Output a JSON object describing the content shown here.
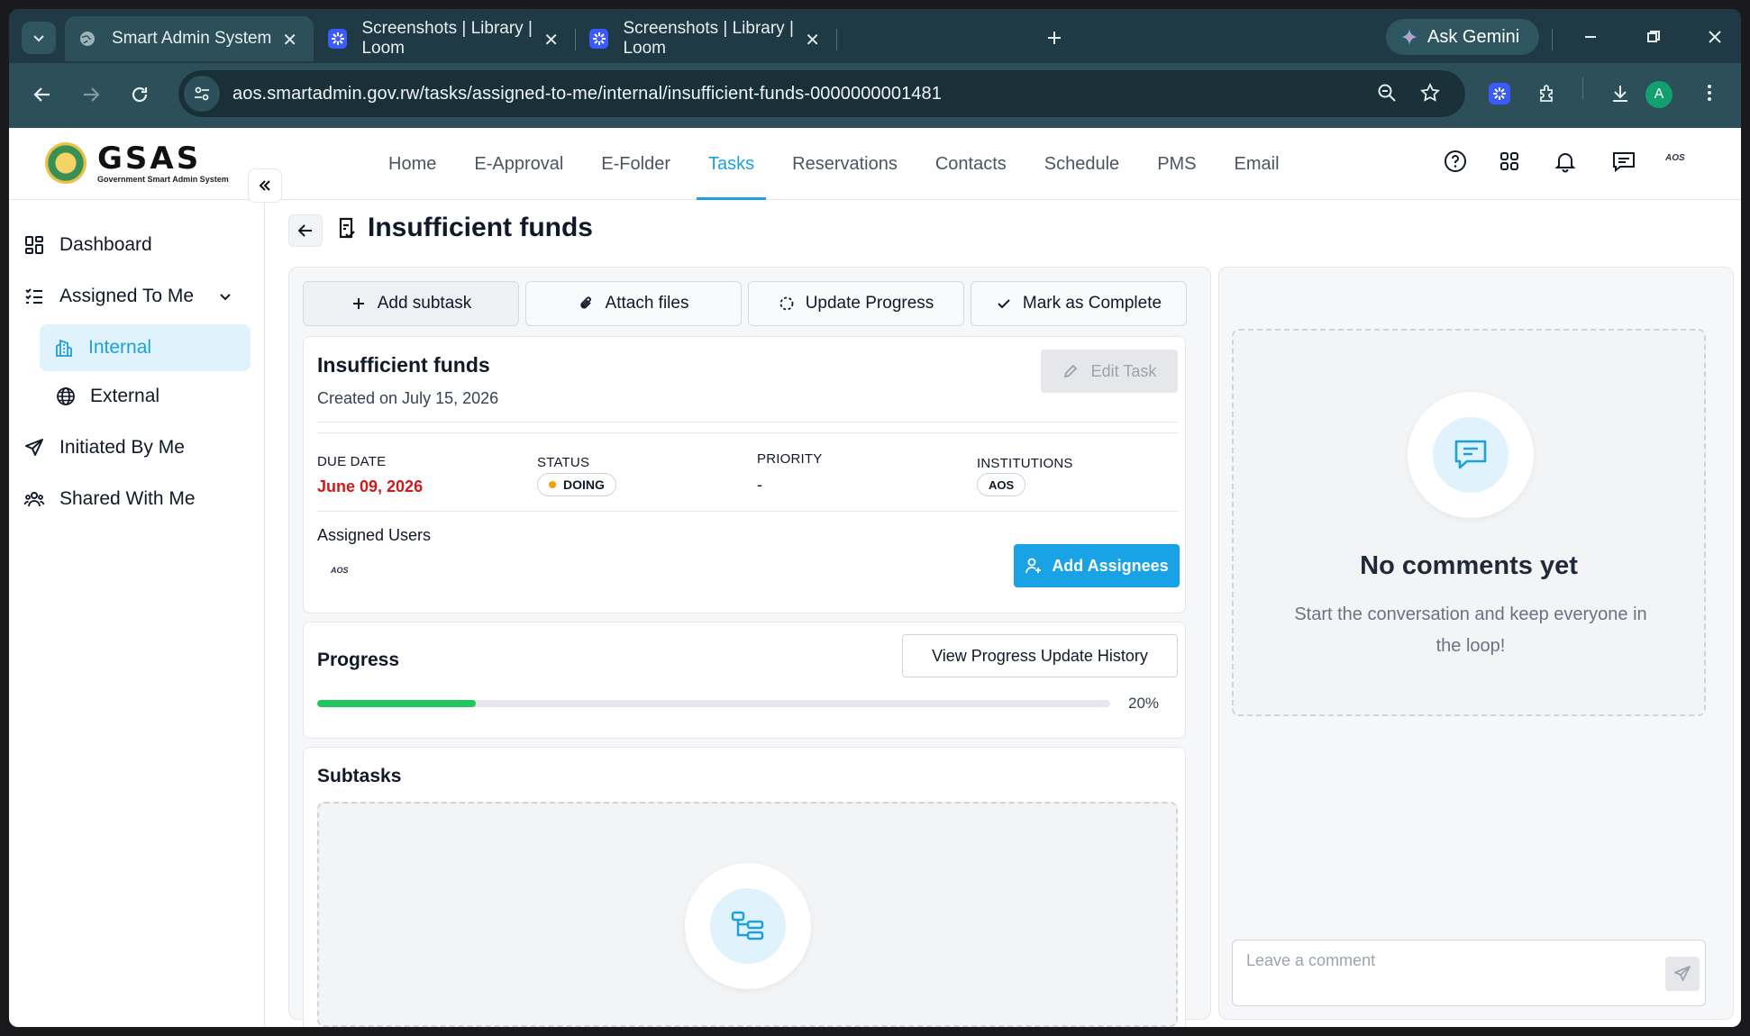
{
  "browser": {
    "tabs": [
      {
        "title": "Smart Admin System",
        "active": true
      },
      {
        "title": "Screenshots | Library | Loom",
        "active": false
      },
      {
        "title": "Screenshots | Library | Loom",
        "active": false
      }
    ],
    "gemini_label": "Ask Gemini",
    "url": "aos.smartadmin.gov.rw/tasks/assigned-to-me/internal/insufficient-funds-0000000001481",
    "profile_initial": "A",
    "accent": "#1ea0dc"
  },
  "header": {
    "logo_name": "GSAS",
    "logo_subtitle": "Government Smart Admin System",
    "nav": [
      "Home",
      "E-Approval",
      "E-Folder",
      "Tasks",
      "Reservations",
      "Contacts",
      "Schedule",
      "PMS",
      "Email"
    ],
    "active_nav": "Tasks",
    "user_badge": "AOS"
  },
  "sidebar": {
    "items": [
      {
        "label": "Dashboard",
        "icon": "dashboard-icon"
      },
      {
        "label": "Assigned To Me",
        "icon": "list-check-icon"
      },
      {
        "label": "Internal",
        "icon": "building-icon",
        "active": true
      },
      {
        "label": "External",
        "icon": "globe-icon"
      },
      {
        "label": "Initiated By Me",
        "icon": "send-icon"
      },
      {
        "label": "Shared With Me",
        "icon": "users-icon"
      }
    ]
  },
  "task": {
    "page_title": "Insufficient funds",
    "actions": [
      "Add subtask",
      "Attach files",
      "Update Progress",
      "Mark as Complete"
    ],
    "name": "Insufficient funds",
    "created": "Created on July 15, 2026",
    "edit_label": "Edit Task",
    "fields": {
      "due_label": "DUE DATE",
      "due_value": "June 09, 2026",
      "status_label": "STATUS",
      "status_value": "DOING",
      "priority_label": "PRIORITY",
      "priority_value": "-",
      "institutions_label": "INSTITUTIONS",
      "institutions_value": "AOS"
    },
    "assigned_label": "Assigned Users",
    "assigned_avatar": "AOS",
    "add_assignees_label": "Add Assignees",
    "progress_title": "Progress",
    "progress_history_label": "View Progress Update History",
    "progress_percent": 20,
    "progress_text": "20%",
    "subtasks_title": "Subtasks"
  },
  "comments": {
    "empty_title": "No comments yet",
    "empty_subtitle": "Start the conversation and keep everyone in the loop!",
    "input_placeholder": "Leave a comment"
  }
}
